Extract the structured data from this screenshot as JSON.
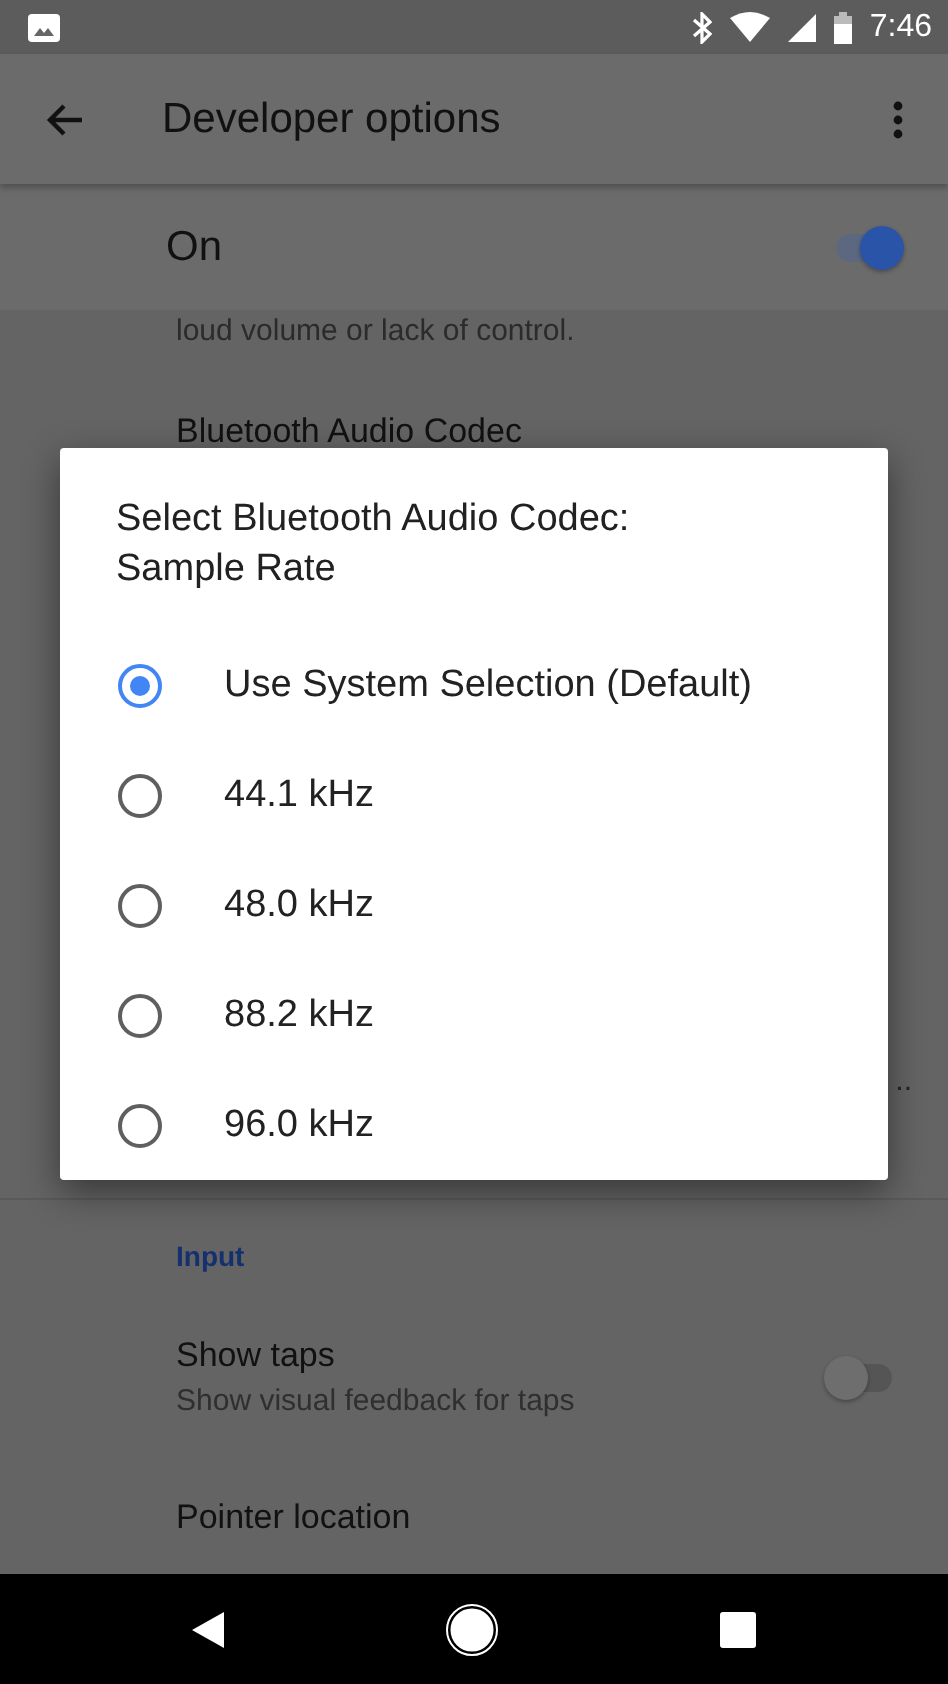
{
  "status_bar": {
    "time": "7:46"
  },
  "app_bar": {
    "title": "Developer options"
  },
  "master_switch": {
    "label": "On",
    "on": true
  },
  "background_list": [
    {
      "kind": "subtitle",
      "text": "loud volume or lack of control."
    },
    {
      "kind": "title",
      "text": "Bluetooth Audio Codec"
    },
    {
      "kind": "overflow",
      "text": ".."
    }
  ],
  "section": {
    "header": "Input"
  },
  "settings": [
    {
      "title": "Show taps",
      "subtitle": "Show visual feedback for taps",
      "on": false
    },
    {
      "title": "Pointer location"
    }
  ],
  "dialog": {
    "title_lines": [
      "Select Bluetooth Audio Codec:",
      "Sample Rate"
    ],
    "options": [
      {
        "label": "Use System Selection (Default)",
        "selected": true
      },
      {
        "label": "44.1 kHz",
        "selected": false
      },
      {
        "label": "48.0 kHz",
        "selected": false
      },
      {
        "label": "88.2 kHz",
        "selected": false
      },
      {
        "label": "96.0 kHz",
        "selected": false
      }
    ]
  }
}
